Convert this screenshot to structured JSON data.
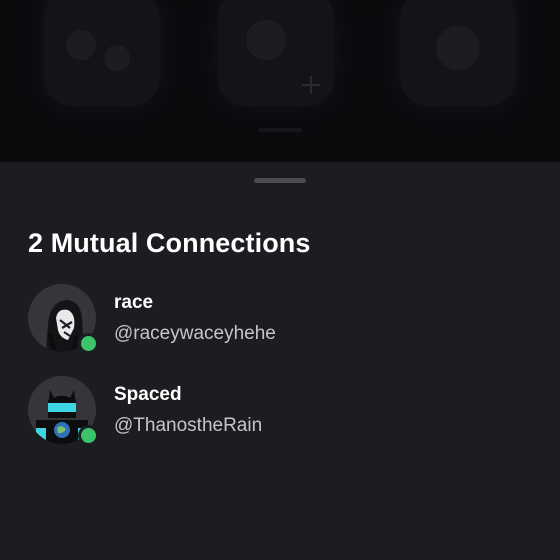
{
  "sheet": {
    "title": "2 Mutual Connections"
  },
  "connections": [
    {
      "name": "race",
      "username": "@raceywaceyhehe",
      "status": "online",
      "status_color": "#3cc46a"
    },
    {
      "name": "Spaced",
      "username": "@ThanostheRain",
      "status": "online",
      "status_color": "#3cc46a"
    }
  ]
}
